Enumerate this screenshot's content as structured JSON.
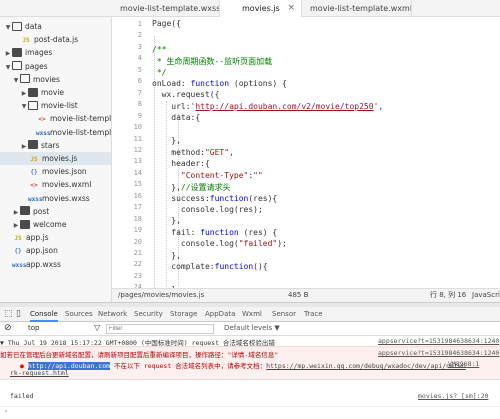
{
  "tabs": [
    {
      "label": "movie-list-template.wxss",
      "active": false
    },
    {
      "label": "movies.js",
      "active": true
    },
    {
      "label": "movie-list-template.wxml",
      "active": false
    }
  ],
  "tree": [
    {
      "label": "data",
      "type": "folder",
      "open": true
    },
    {
      "label": "post-data.js",
      "type": "js"
    },
    {
      "label": "images",
      "type": "folder",
      "open": false
    },
    {
      "label": "pages",
      "type": "folder",
      "open": true
    },
    {
      "label": "movies",
      "type": "folder",
      "open": true
    },
    {
      "label": "movie",
      "type": "folder",
      "open": false
    },
    {
      "label": "movie-list",
      "type": "folder",
      "open": true
    },
    {
      "label": "movie-list-templat...",
      "type": "wxml"
    },
    {
      "label": "movie-list-templat...",
      "type": "wxss"
    },
    {
      "label": "stars",
      "type": "folder",
      "open": false
    },
    {
      "label": "movies.js",
      "type": "js",
      "selected": true
    },
    {
      "label": "movies.json",
      "type": "json"
    },
    {
      "label": "movies.wxml",
      "type": "wxml"
    },
    {
      "label": "movies.wxss",
      "type": "wxss"
    },
    {
      "label": "post",
      "type": "folder",
      "open": false
    },
    {
      "label": "welcome",
      "type": "folder",
      "open": false
    },
    {
      "label": "app.js",
      "type": "js"
    },
    {
      "label": "app.json",
      "type": "json"
    },
    {
      "label": "app.wxss",
      "type": "wxss"
    }
  ],
  "file_tags": {
    "js": "JS",
    "json": "{}",
    "wxml": "<>",
    "wxss": "wxss"
  },
  "code": {
    "line_numbers": [
      "1",
      "2",
      "3",
      "4",
      "5",
      "6",
      "7",
      "8",
      "9",
      "10",
      "11",
      "12",
      "13",
      "14",
      "15",
      "16",
      "17",
      "18",
      "19",
      "20",
      "21",
      "22",
      "23",
      "24",
      "25",
      "26"
    ],
    "l1": "Page({",
    "l3": "/**",
    "l4": " * 生命周期函数--监听页面加载",
    "l5": " */",
    "l6a": "onLoad: ",
    "l6b": "function",
    "l6c": " (options) {",
    "l7": "  wx.request({",
    "l8a": "    url:",
    "l8b": "'",
    "l8c": "http://api.douban.com/v2/movie/top250",
    "l8d": "',",
    "l9": "    data:{",
    "l11": "    },",
    "l12a": "    method:",
    "l12b": "\"GET\"",
    "l12c": ",",
    "l13": "    header:{",
    "l14a": "      ",
    "l14b": "\"Content-Type\"",
    "l14c": ":",
    "l14d": "\"\"",
    "l15a": "    },",
    "l15b": "//设置请求头",
    "l16a": "    success:",
    "l16b": "function",
    "l16c": "(res){",
    "l17": "      console.log(res);",
    "l18": "    },",
    "l19a": "    fail: ",
    "l19b": "function",
    "l19c": " (res) {",
    "l20a": "      console.log(",
    "l20b": "\"failed\"",
    "l20c": ");",
    "l21": "    },",
    "l22a": "    complate:",
    "l22b": "function",
    "l22c": "(){",
    "l24": "    }"
  },
  "status": {
    "path": "/pages/movies/movies.js",
    "size": "485 B",
    "cursor": "行 8, 列 16",
    "lang": "JavaScri"
  },
  "devtools_tabs": [
    "Console",
    "Sources",
    "Network",
    "Security",
    "Storage",
    "AppData",
    "Wxml",
    "Sensor",
    "Trace"
  ],
  "toolbar": {
    "context": "top",
    "filter_placeholder": "Filter",
    "levels": "Default levels ▼"
  },
  "console": {
    "l1": "▼ Thu Jul 19 2018 15:17:22 GMT+0800 (中国标准时间) request 合法域名校验出错",
    "l1src": "appservice?t=1531984638634:1240",
    "l2": "  如若已在管理后台更新域名配置，请刷新项目配置后重新编译项目，操作路径：\"详情-域名信息\"",
    "l2src": "appservice?t=1531984638634:1240",
    "l3hl": "http://api.douban.com",
    "l3mid": " 不在以下 request 合法域名列表中，请参考文档：",
    "l3link": "https://mp.weixin.qq.com/debug/wxadoc/dev/api/netwo",
    "l3src": "VM8968:1",
    "l4": "rk-request.html",
    "l5": "failed",
    "l5src": "movies.js? [sm]:20"
  }
}
